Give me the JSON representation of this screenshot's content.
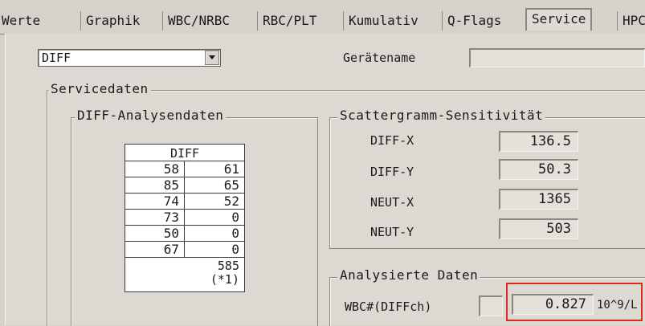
{
  "tabs": [
    "Werte",
    "Graphik",
    "WBC/NRBC",
    "RBC/PLT",
    "Kumulativ",
    "Q-Flags",
    "Service",
    "HPC"
  ],
  "active_tab": "Service",
  "mode_select": {
    "value": "DIFF"
  },
  "device_name": {
    "label": "Gerätename",
    "value": ""
  },
  "service_data": {
    "title": "Servicedaten",
    "diff_analysis": {
      "title": "DIFF-Analysendaten",
      "table_header": "DIFF",
      "rows": [
        [
          "58",
          "61"
        ],
        [
          "85",
          "65"
        ],
        [
          "74",
          "52"
        ],
        [
          "73",
          "0"
        ],
        [
          "50",
          "0"
        ],
        [
          "67",
          "0"
        ]
      ],
      "total": "585",
      "total_note": "(*1)"
    },
    "scatter_sensitivity": {
      "title": "Scattergramm-Sensitivität",
      "items": [
        {
          "label": "DIFF-X",
          "value": "136.5"
        },
        {
          "label": "DIFF-Y",
          "value": "50.3"
        },
        {
          "label": "NEUT-X",
          "value": "1365"
        },
        {
          "label": "NEUT-Y",
          "value": "503"
        }
      ]
    },
    "analyzed_data": {
      "title": "Analysierte Daten",
      "wbc_label": "WBC#(DIFFch)",
      "wbc_value": "0.827",
      "wbc_unit": "10^9/L"
    }
  },
  "colors": {
    "highlight": "#e0281e",
    "window_bg": "#d5d2cb"
  }
}
